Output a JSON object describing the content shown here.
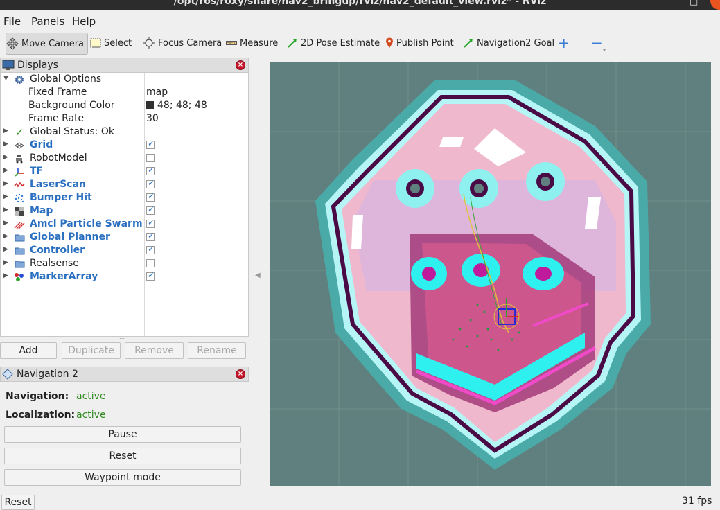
{
  "window": {
    "title": "/opt/ros/roxy/share/nav2_bringup/rviz/nav2_default_view.rviz* - RViz",
    "min_glyph": "_",
    "max_glyph": "□"
  },
  "menu": [
    "File",
    "Panels",
    "Help"
  ],
  "toolbar": {
    "tools": [
      {
        "label": "Move Camera",
        "icon": "move-camera-icon",
        "active": true
      },
      {
        "label": "Select",
        "icon": "select-icon"
      },
      {
        "label": "Focus Camera",
        "icon": "focus-camera-icon"
      },
      {
        "label": "Measure",
        "icon": "ruler-icon"
      },
      {
        "label": "2D Pose Estimate",
        "icon": "pose-arrow-icon"
      },
      {
        "label": "Publish Point",
        "icon": "map-pin-icon"
      },
      {
        "label": "Navigation2 Goal",
        "icon": "goal-arrow-icon"
      }
    ],
    "add_tool_glyph": "+",
    "remove_tool_glyph": "−"
  },
  "displays": {
    "title": "Displays",
    "rows": [
      {
        "label": "Global Options",
        "icon": "gear-icon",
        "expanded": true
      },
      {
        "label": "Fixed Frame",
        "value": "map",
        "child": true
      },
      {
        "label": "Background Color",
        "value": "48; 48; 48",
        "child": true,
        "swatch": "#303030"
      },
      {
        "label": "Frame Rate",
        "value": "30",
        "child": true
      },
      {
        "label": "Global Status: Ok",
        "icon": "checkmark-icon"
      },
      {
        "label": "Grid",
        "icon": "grid-icon",
        "checked": true,
        "blue": true
      },
      {
        "label": "RobotModel",
        "icon": "robot-icon",
        "checked": false
      },
      {
        "label": "TF",
        "icon": "tf-axes-icon",
        "checked": true,
        "blue": true
      },
      {
        "label": "LaserScan",
        "icon": "laser-scan-icon",
        "checked": true,
        "blue": true
      },
      {
        "label": "Bumper Hit",
        "icon": "point-cloud-icon",
        "checked": true,
        "blue": true
      },
      {
        "label": "Map",
        "icon": "map-icon",
        "checked": true,
        "blue": true
      },
      {
        "label": "Amcl Particle Swarm",
        "icon": "particle-arrows-icon",
        "checked": true,
        "blue": true
      },
      {
        "label": "Global Planner",
        "icon": "folder-icon",
        "checked": true,
        "blue": true
      },
      {
        "label": "Controller",
        "icon": "folder-icon",
        "checked": true,
        "blue": true
      },
      {
        "label": "Realsense",
        "icon": "folder-icon",
        "checked": false
      },
      {
        "label": "MarkerArray",
        "icon": "marker-array-icon",
        "checked": true,
        "blue": true
      }
    ],
    "buttons": {
      "add": "Add",
      "duplicate": "Duplicate",
      "remove": "Remove",
      "rename": "Rename"
    }
  },
  "navigation": {
    "title": "Navigation 2",
    "navigation_label": "Navigation:",
    "navigation_value": "active",
    "localization_label": "Localization:",
    "localization_value": "active",
    "pause": "Pause",
    "reset": "Reset",
    "waypoint": "Waypoint mode"
  },
  "statusbar": {
    "reset": "Reset",
    "fps": "31 fps"
  },
  "colors": {
    "accent_blue": "#2a6fc0",
    "active_green": "#2e8b1e",
    "viewport_bg": "#5f807e",
    "close_red": "#c7162b"
  }
}
